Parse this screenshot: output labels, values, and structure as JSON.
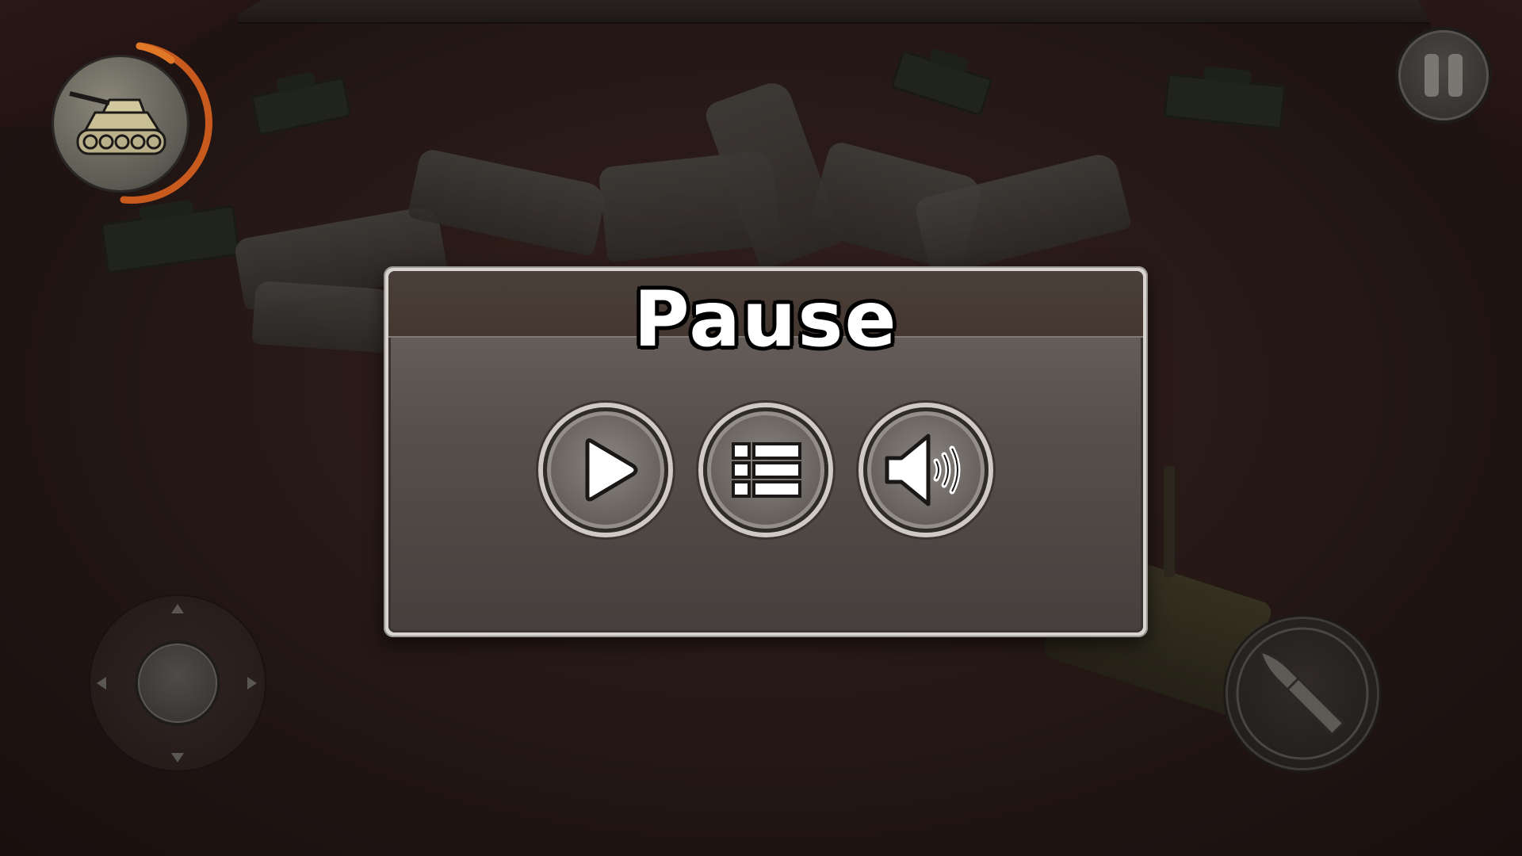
{
  "dialog": {
    "title": "Pause",
    "buttons": [
      {
        "name": "resume",
        "icon": "play-icon"
      },
      {
        "name": "menu",
        "icon": "list-icon"
      },
      {
        "name": "sound",
        "icon": "speaker-icon"
      }
    ]
  },
  "hud": {
    "player_icon": "tank-icon",
    "health_ring_color": "#d06020",
    "pause_icon": "pause-icon",
    "fire_icon": "bullet-icon"
  }
}
